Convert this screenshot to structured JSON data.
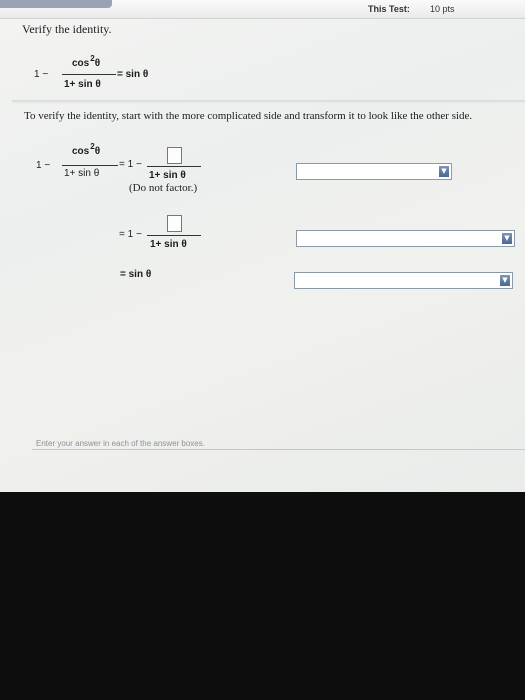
{
  "header": {
    "test_label": "This Test:",
    "points": "10 pts"
  },
  "question": {
    "prompt": "Verify the identity.",
    "identity": {
      "lhs_one": "1 −",
      "numerator": "cos",
      "exponent": "2",
      "theta": "θ",
      "denominator": "1+ sin θ",
      "rhs": "= sin θ"
    }
  },
  "instruction": "To verify the identity, start with the more complicated side and transform it to look like the other side.",
  "steps": [
    {
      "lhs_one": "1 −",
      "numerator": "cos",
      "exponent": "2",
      "theta": "θ",
      "denominator": "1+ sin θ",
      "eq_prefix": "= 1 −",
      "box_denominator": "1+ sin θ",
      "note": "(Do not factor.)",
      "dropdown_value": ""
    },
    {
      "eq_prefix": "= 1 −",
      "box_denominator": "1+ sin θ",
      "dropdown_value": ""
    },
    {
      "result": "= sin θ",
      "dropdown_value": ""
    }
  ],
  "hint": "Enter your answer in each of the answer boxes.",
  "icons": {
    "dropdown": "chevron-down-icon"
  }
}
